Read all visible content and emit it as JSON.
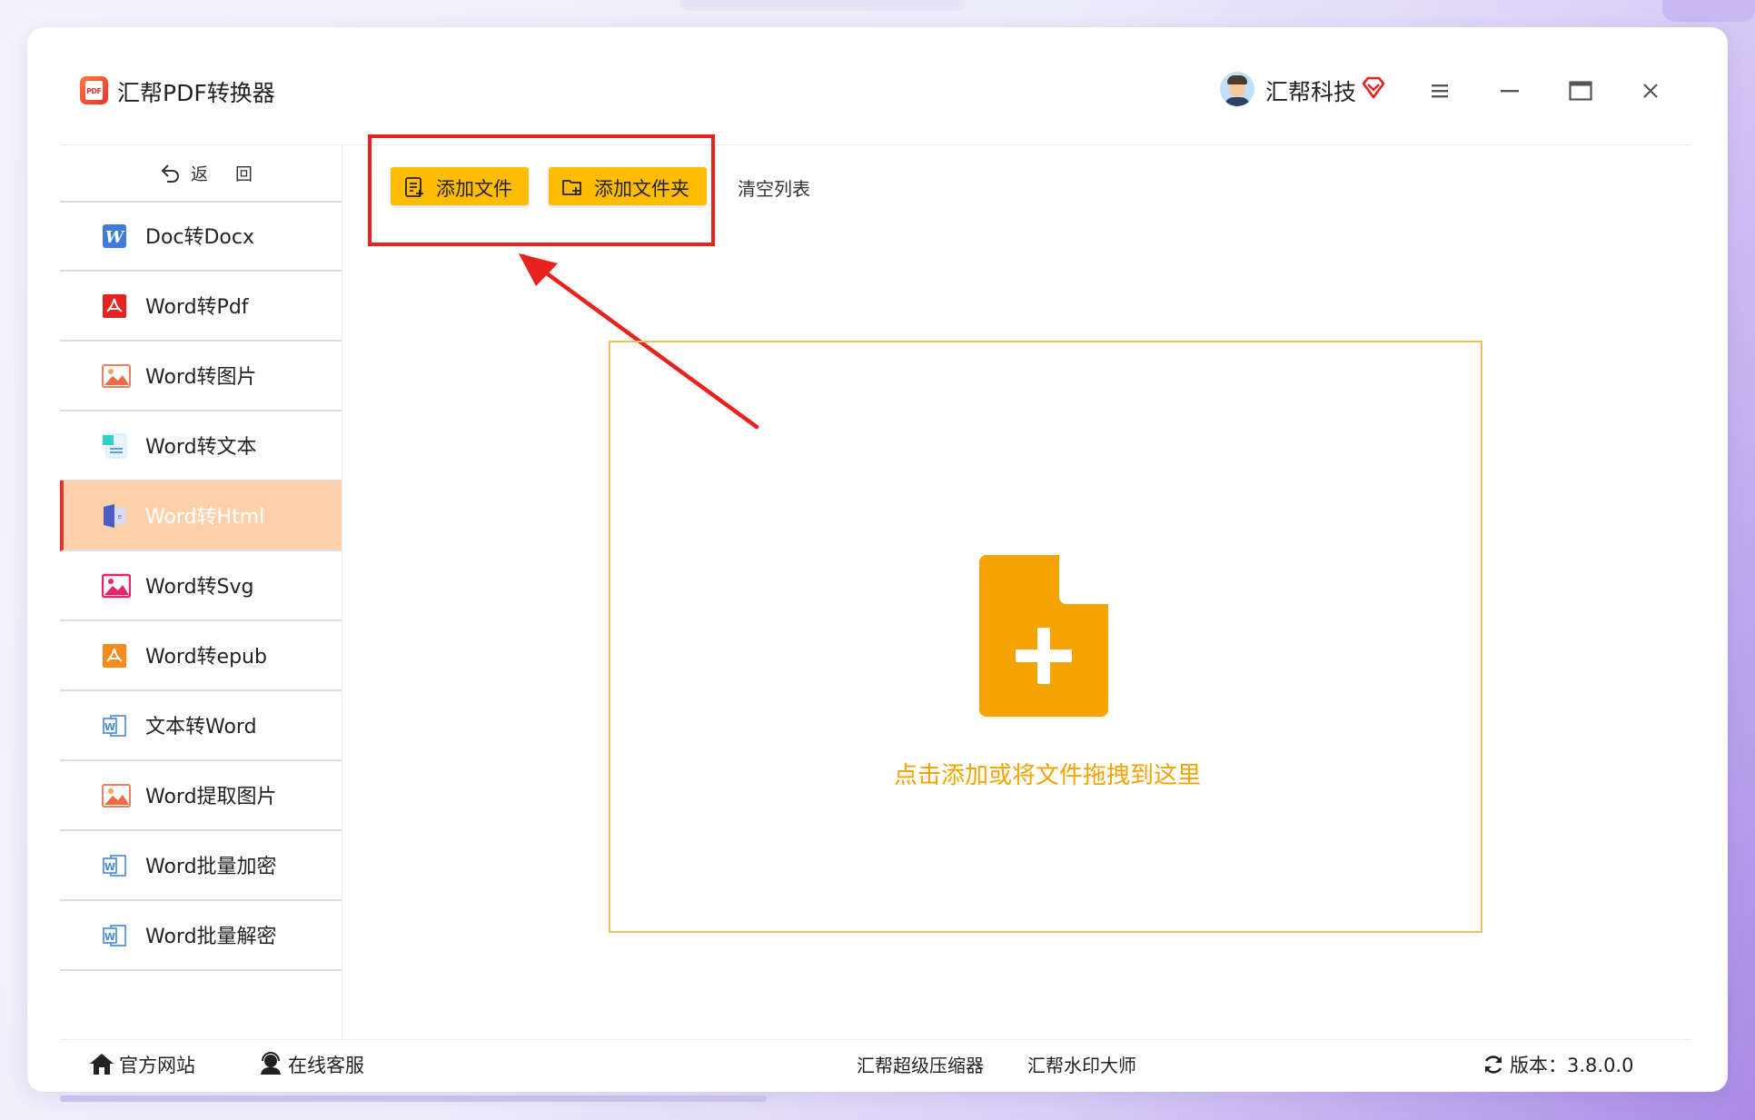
{
  "app": {
    "title": "汇帮PDF转换器",
    "logo_text": "PDF"
  },
  "user": {
    "name": "汇帮科技"
  },
  "sidebar": {
    "back_label": "返 回",
    "items": [
      {
        "label": "Doc转Docx",
        "icon": "word-w-icon"
      },
      {
        "label": "Word转Pdf",
        "icon": "pdf-icon"
      },
      {
        "label": "Word转图片",
        "icon": "image-icon"
      },
      {
        "label": "Word转文本",
        "icon": "text-doc-icon"
      },
      {
        "label": "Word转Html",
        "icon": "html-icon",
        "active": true
      },
      {
        "label": "Word转Svg",
        "icon": "svg-image-icon"
      },
      {
        "label": "Word转epub",
        "icon": "epub-icon"
      },
      {
        "label": "文本转Word",
        "icon": "word-outline-icon"
      },
      {
        "label": "Word提取图片",
        "icon": "image-icon"
      },
      {
        "label": "Word批量加密",
        "icon": "word-outline-icon"
      },
      {
        "label": "Word批量解密",
        "icon": "word-outline-icon"
      }
    ]
  },
  "toolbar": {
    "add_file": "添加文件",
    "add_folder": "添加文件夹",
    "clear_list": "清空列表"
  },
  "drop_zone": {
    "text": "点击添加或将文件拖拽到这里"
  },
  "footer": {
    "official_site": "官方网站",
    "online_service": "在线客服",
    "compressor": "汇帮超级压缩器",
    "watermark": "汇帮水印大师",
    "version": "版本：3.8.0.0"
  },
  "colors": {
    "accent": "#ffbc00",
    "drop_text": "#f5a300",
    "active_item_bg": "#ffd1aa",
    "highlight": "#e8221e"
  }
}
